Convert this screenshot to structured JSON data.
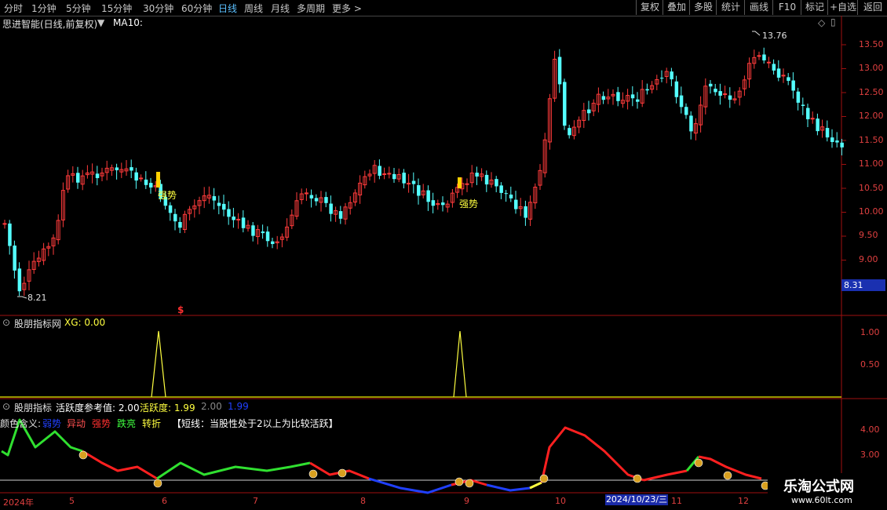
{
  "toolbar": {
    "periods": [
      "分时",
      "1分钟",
      "5分钟",
      "15分钟",
      "30分钟",
      "60分钟",
      "日线",
      "周线",
      "月线",
      "多周期",
      "更多 >"
    ],
    "active_period": "日线",
    "right_buttons": [
      "复权",
      "叠加",
      "多股",
      "统计",
      "画线",
      "F10",
      "标记",
      "+自选",
      "返回"
    ]
  },
  "main_panel": {
    "title": "思进智能(日线,前复权)",
    "ma_label": "MA10:",
    "price_axis": [
      "13.50",
      "13.00",
      "12.50",
      "12.00",
      "11.50",
      "11.00",
      "10.50",
      "10.00",
      "9.50",
      "9.00"
    ],
    "high_marker": "13.76",
    "low_marker": "8.21",
    "current_price": "8.31",
    "signal_label": "强势",
    "dollar_marker": "$"
  },
  "mid_panel": {
    "title": "股朋指标网",
    "xg_label": "XG: 0.00",
    "axis": [
      "1.00",
      "0.50"
    ]
  },
  "bottom_panel": {
    "title": "股朋指标",
    "ref_label": "活跃度参考值: 2.00",
    "active_label": "活跃度: 1.99",
    "val2": "2.00",
    "val3": "1.99",
    "legend_prefix": "颜色含义:",
    "legend": [
      {
        "label": "弱势",
        "color": "#2040ff"
      },
      {
        "label": "异动",
        "color": "#ff5050"
      },
      {
        "label": "强势",
        "color": "#ff3030"
      },
      {
        "label": "跌亮",
        "color": "#40ff40"
      },
      {
        "label": "转折",
        "color": "#ffff40"
      }
    ],
    "note": "【短线：当股性处于2以上为比较活跃】",
    "axis": [
      "4.00",
      "3.00"
    ]
  },
  "date_axis": [
    "2024年",
    "5",
    "6",
    "7",
    "8",
    "9",
    "10",
    "11",
    "12"
  ],
  "selected_date": "2024/10/23/三",
  "watermark": {
    "title": "乐淘公式网",
    "url": "www.60lt.com"
  },
  "colors": {
    "up": "#ff3b3b",
    "down": "#54ffff",
    "signal": "#ffd000",
    "axis": "#a01010",
    "strong": "#ff2020",
    "weak": "#2040ff",
    "jump": "#30e030"
  }
}
